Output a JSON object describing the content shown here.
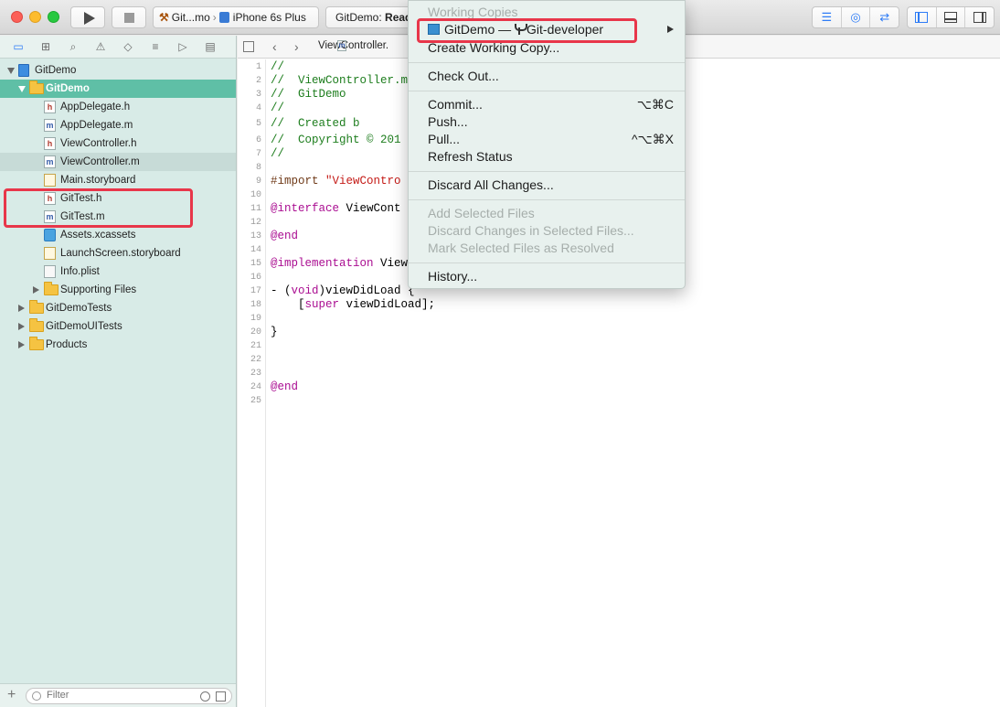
{
  "toolbar": {
    "scheme_target": "Git...mo",
    "scheme_device": "iPhone 6s Plus",
    "status_project": "GitDemo:",
    "status_text": "Read"
  },
  "navigator": {
    "filter_placeholder": "Filter",
    "tree": [
      {
        "label": "GitDemo",
        "icon": "project-icon",
        "depth": 0,
        "disclosure": "open",
        "state": "normal"
      },
      {
        "label": "GitDemo",
        "icon": "folder-icon",
        "depth": 1,
        "disclosure": "open",
        "state": "selected"
      },
      {
        "label": "AppDelegate.h",
        "icon": "header-file-icon",
        "icon_glyph": "h",
        "depth": 2,
        "state": "normal"
      },
      {
        "label": "AppDelegate.m",
        "icon": "implementation-file-icon",
        "icon_glyph": "m",
        "depth": 2,
        "state": "normal"
      },
      {
        "label": "ViewController.h",
        "icon": "header-file-icon",
        "icon_glyph": "h",
        "depth": 2,
        "state": "normal"
      },
      {
        "label": "ViewController.m",
        "icon": "implementation-file-icon",
        "icon_glyph": "m",
        "depth": 2,
        "state": "highlighted"
      },
      {
        "label": "Main.storyboard",
        "icon": "storyboard-icon",
        "depth": 2,
        "state": "normal"
      },
      {
        "label": "GitTest.h",
        "icon": "header-file-icon",
        "icon_glyph": "h",
        "depth": 2,
        "state": "normal"
      },
      {
        "label": "GitTest.m",
        "icon": "implementation-file-icon",
        "icon_glyph": "m",
        "depth": 2,
        "state": "normal"
      },
      {
        "label": "Assets.xcassets",
        "icon": "asset-catalog-icon",
        "depth": 2,
        "state": "normal"
      },
      {
        "label": "LaunchScreen.storyboard",
        "icon": "storyboard-icon",
        "depth": 2,
        "state": "normal"
      },
      {
        "label": "Info.plist",
        "icon": "plist-icon",
        "depth": 2,
        "state": "normal"
      },
      {
        "label": "Supporting Files",
        "icon": "folder-icon",
        "depth": 2,
        "disclosure": "closed",
        "state": "normal"
      },
      {
        "label": "GitDemoTests",
        "icon": "folder-icon",
        "depth": 1,
        "disclosure": "closed",
        "state": "normal"
      },
      {
        "label": "GitDemoUITests",
        "icon": "folder-icon",
        "depth": 1,
        "disclosure": "closed",
        "state": "normal"
      },
      {
        "label": "Products",
        "icon": "folder-icon",
        "depth": 1,
        "disclosure": "closed",
        "state": "normal"
      }
    ]
  },
  "editor": {
    "breadcrumb_file": "ViewController.",
    "lines": [
      {
        "n": "1",
        "segs": [
          {
            "t": "//",
            "c": "comment"
          }
        ]
      },
      {
        "n": "2",
        "segs": [
          {
            "t": "//  ViewController.m",
            "c": "comment"
          }
        ]
      },
      {
        "n": "3",
        "segs": [
          {
            "t": "//  GitDemo",
            "c": "comment"
          }
        ]
      },
      {
        "n": "4",
        "segs": [
          {
            "t": "//",
            "c": "comment"
          }
        ]
      },
      {
        "n": "5",
        "segs": [
          {
            "t": "//  Created b",
            "c": "comment"
          }
        ]
      },
      {
        "n": "6",
        "segs": [
          {
            "t": "//  Copyright © 201",
            "c": "comment"
          }
        ]
      },
      {
        "n": "7",
        "segs": [
          {
            "t": "//",
            "c": "comment"
          }
        ]
      },
      {
        "n": "8",
        "segs": []
      },
      {
        "n": "9",
        "segs": [
          {
            "t": "#import ",
            "c": "pre"
          },
          {
            "t": "\"ViewContro",
            "c": "str"
          }
        ]
      },
      {
        "n": "10",
        "segs": []
      },
      {
        "n": "11",
        "segs": [
          {
            "t": "@interface",
            "c": "kw"
          },
          {
            "t": " ViewCont",
            "c": "plain"
          }
        ]
      },
      {
        "n": "12",
        "segs": []
      },
      {
        "n": "13",
        "segs": [
          {
            "t": "@end",
            "c": "kw"
          }
        ]
      },
      {
        "n": "14",
        "segs": []
      },
      {
        "n": "15",
        "segs": [
          {
            "t": "@implementation",
            "c": "kw"
          },
          {
            "t": " View",
            "c": "plain"
          }
        ]
      },
      {
        "n": "16",
        "segs": []
      },
      {
        "n": "17",
        "segs": [
          {
            "t": "- (",
            "c": "plain"
          },
          {
            "t": "void",
            "c": "kw"
          },
          {
            "t": ")viewDidLoad {",
            "c": "plain"
          }
        ]
      },
      {
        "n": "18",
        "segs": [
          {
            "t": "    [",
            "c": "plain"
          },
          {
            "t": "super",
            "c": "kw"
          },
          {
            "t": " viewDidLoad];",
            "c": "plain"
          }
        ]
      },
      {
        "n": "19",
        "segs": []
      },
      {
        "n": "20",
        "segs": [
          {
            "t": "}",
            "c": "plain"
          }
        ]
      },
      {
        "n": "21",
        "segs": []
      },
      {
        "n": "22",
        "segs": []
      },
      {
        "n": "23",
        "segs": []
      },
      {
        "n": "24",
        "segs": [
          {
            "t": "@end",
            "c": "kw"
          }
        ]
      },
      {
        "n": "25",
        "segs": []
      }
    ]
  },
  "source_control_menu": {
    "working_copies_header": "Working Copies",
    "repo_item": {
      "name": "GitDemo —",
      "branch": "Git-developer"
    },
    "create_working_copy": "Create Working Copy...",
    "check_out": "Check Out...",
    "commit": {
      "label": "Commit...",
      "shortcut": "⌥⌘C"
    },
    "push": "Push...",
    "pull": {
      "label": "Pull...",
      "shortcut": "^⌥⌘X"
    },
    "refresh_status": "Refresh Status",
    "discard_all": "Discard All Changes...",
    "add_selected": "Add Selected Files",
    "discard_selected": "Discard Changes in Selected Files...",
    "mark_resolved": "Mark Selected Files as Resolved",
    "history": "History..."
  },
  "colors": {
    "selection": "#5fbfa6",
    "annotation": "#e8364a",
    "accent": "#2e7cf6"
  }
}
